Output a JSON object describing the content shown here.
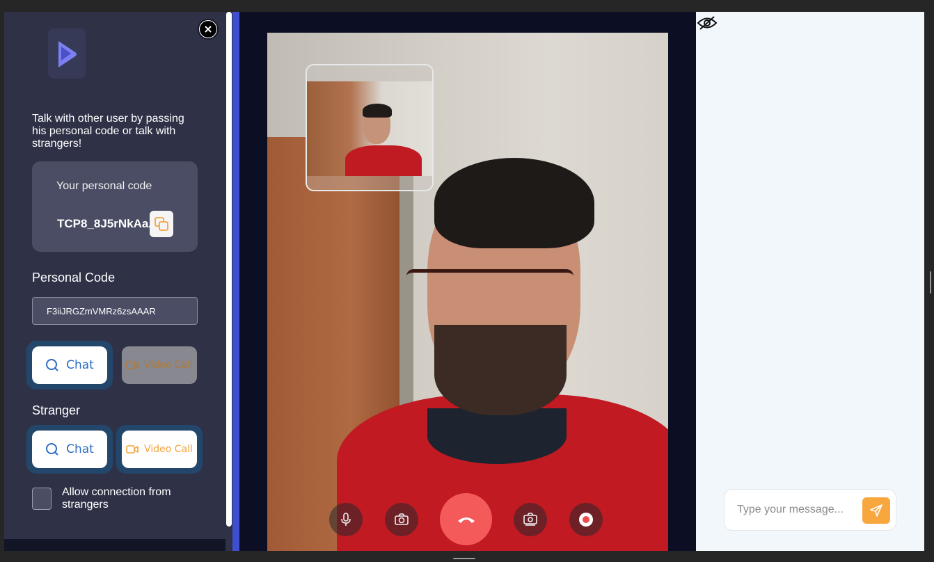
{
  "sidebar": {
    "intro_text": "Talk with other user by passing his personal code or talk with strangers!",
    "personal_code_label": "Your personal code",
    "personal_code_value": "TCP8_8J5rNkAaAAAR",
    "personal_code_section_title": "Personal Code",
    "personal_code_input_value": "F3iiJRGZmVMRz6zsAAAR",
    "personal_buttons": {
      "chat_label": "Chat",
      "video_label": "Video Call"
    },
    "stranger_section_title": "Stranger",
    "stranger_buttons": {
      "chat_label": "Chat",
      "video_label": "Video Call"
    },
    "allow_strangers_label": "Allow connection from strangers",
    "allow_strangers_checked": false
  },
  "call_controls": {
    "icons": [
      "microphone-icon",
      "camera-icon",
      "hang-up-icon",
      "switch-camera-icon",
      "record-icon"
    ]
  },
  "chat": {
    "message_placeholder": "Type your message...",
    "message_value": ""
  },
  "colors": {
    "sidebar_bg": "#2f3247",
    "accent_blue": "#2b6cc4",
    "accent_orange": "#f5a33a",
    "hangup_red": "#f45a5a",
    "video_bg": "#0c0e23",
    "chat_bg": "#f2f7fc"
  }
}
